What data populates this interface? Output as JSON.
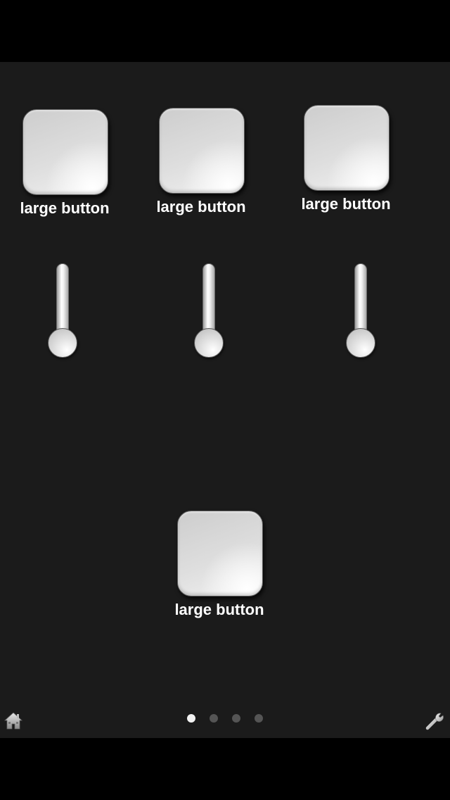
{
  "buttons": [
    {
      "label": "large button"
    },
    {
      "label": "large button"
    },
    {
      "label": "large button"
    },
    {
      "label": "large button"
    }
  ],
  "sliders": [
    {
      "value": 0
    },
    {
      "value": 0
    },
    {
      "value": 0
    }
  ],
  "pager": {
    "pages": 4,
    "current": 1
  },
  "footer": {
    "left_icon": "home-icon",
    "right_icon": "wrench-icon"
  },
  "colors": {
    "background": "#1b1b1b",
    "label": "#ffffff",
    "dot_active": "#f2f2f2",
    "dot_inactive": "#555555"
  }
}
